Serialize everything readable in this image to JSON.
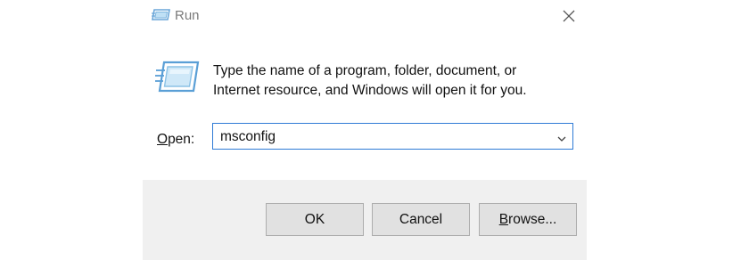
{
  "window": {
    "title": "Run",
    "close_icon": "close-icon",
    "app_icon": "run-app-icon"
  },
  "body": {
    "icon": "run-dialog-icon",
    "description_line1": "Type the name of a program, folder, document, or",
    "description_line2": "Internet resource, and Windows will open it for you."
  },
  "open_field": {
    "label_underlined": "O",
    "label_rest": "pen:",
    "value": "msconfig",
    "dropdown_icon": "chevron-down-icon"
  },
  "buttons": {
    "ok": "OK",
    "cancel": "Cancel",
    "browse_underlined": "B",
    "browse_rest": "rowse..."
  },
  "colors": {
    "focus_border": "#2f7bd6",
    "footer_bg": "#f0f0f0",
    "button_bg": "#e1e1e1"
  }
}
